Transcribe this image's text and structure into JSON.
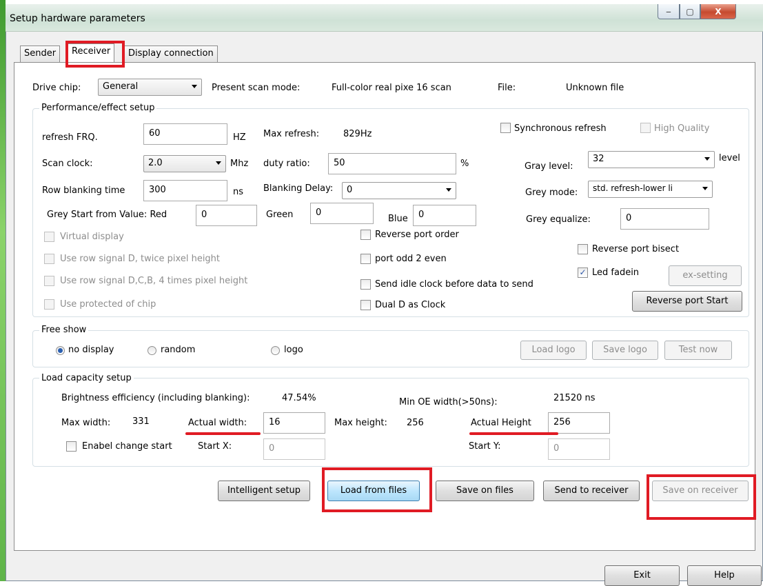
{
  "window": {
    "title": "Setup hardware parameters",
    "minimize_label": "‒",
    "maximize_label": "▢",
    "close_label": "X"
  },
  "tabs": [
    {
      "label": "Sender"
    },
    {
      "label": "Receiver"
    },
    {
      "label": "Display connection"
    }
  ],
  "active_tab": "Receiver",
  "top_row": {
    "drive_chip_label": "Drive chip:",
    "drive_chip_value": "General",
    "present_scan_label": "Present scan mode:",
    "present_scan_value": "Full-color real pixe 16 scan",
    "file_label": "File:",
    "file_value": "Unknown file"
  },
  "performance": {
    "title": "Performance/effect setup",
    "refresh_label": "refresh FRQ.",
    "refresh_value": "60",
    "refresh_unit": "HZ",
    "max_refresh_label": "Max refresh:",
    "max_refresh_value": "829Hz",
    "sync_refresh_label": "Synchronous refresh",
    "high_quality_label": "High Quality",
    "scan_clock_label": "Scan clock:",
    "scan_clock_value": "2.0",
    "scan_clock_unit": "Mhz",
    "duty_ratio_label": "duty ratio:",
    "duty_ratio_value": "50",
    "duty_ratio_unit": "%",
    "gray_level_label": "Gray level:",
    "gray_level_value": "32",
    "gray_level_unit": "level",
    "row_blanking_label": "Row blanking time",
    "row_blanking_value": "300",
    "row_blanking_unit": "ns",
    "blanking_delay_label": "Blanking Delay:",
    "blanking_delay_value": "0",
    "grey_mode_label": "Grey mode:",
    "grey_mode_value": "std. refresh-lower li",
    "grey_start_label": "Grey Start from Value:  Red",
    "red_value": "0",
    "green_label": "Green",
    "green_value": "0",
    "blue_label": "Blue",
    "blue_value": "0",
    "grey_equalize_label": "Grey equalize:",
    "grey_equalize_value": "0",
    "virtual_display_label": "Virtual display",
    "row_signal_d_label": "Use row signal D, twice pixel height",
    "row_signal_dcb_label": "Use row signal D,C,B, 4 times pixel height",
    "protected_chip_label": "Use protected of chip",
    "reverse_port_order_label": "Reverse port order",
    "port_odd_even_label": "port odd 2 even",
    "send_idle_label": "Send idle clock before data to send",
    "dual_d_label": "Dual D as Clock",
    "reverse_port_bisect_label": "Reverse port bisect",
    "led_fadein_label": "Led fadein",
    "led_fadein_check": "✓",
    "ex_setting_label": "ex-setting",
    "reverse_port_start_label": "Reverse port Start"
  },
  "free_show": {
    "title": "Free show",
    "no_display_label": "no display",
    "random_label": "random",
    "logo_label": "logo",
    "load_logo_label": "Load logo",
    "save_logo_label": "Save logo",
    "test_now_label": "Test now"
  },
  "load_capacity": {
    "title": "Load capacity setup",
    "brightness_label": "Brightness efficiency (including blanking):",
    "brightness_value": "47.54%",
    "min_oe_label": "Min OE width(>50ns):",
    "min_oe_value": "21520 ns",
    "max_width_label": "Max width:",
    "max_width_value": "331",
    "actual_width_label": "Actual width:",
    "actual_width_value": "16",
    "max_height_label": "Max height:",
    "max_height_value": "256",
    "actual_height_label": "Actual Height",
    "actual_height_value": "256",
    "enable_change_label": "Enabel change start",
    "start_x_label": "Start X:",
    "start_x_value": "0",
    "start_y_label": "Start Y:",
    "start_y_value": "0"
  },
  "actions": {
    "intelligent_setup": "Intelligent setup",
    "load_from_files": "Load from files",
    "save_on_files": "Save on files",
    "send_to_receiver": "Send to receiver",
    "save_on_receiver": "Save on receiver"
  },
  "footer": {
    "exit_label": "Exit",
    "help_label": "Help"
  },
  "colors": {
    "annotation": "#e01b24",
    "accent": "#2a5fb0"
  }
}
